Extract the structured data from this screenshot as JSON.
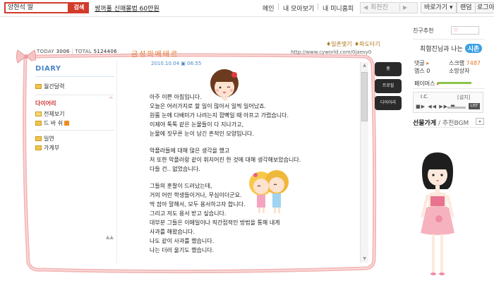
{
  "topbar": {
    "search_value": "앙현석 딸",
    "search_button": "검색",
    "promo_link": "쌍꺼풀 신매몰법 60만원",
    "nav_main": "메인",
    "nav_my_view": "내 모아보기",
    "nav_my_home": "내 미니홈피",
    "prev_label": "최천진",
    "go_dropdown": "바로가기",
    "random": "랜덤",
    "logout": "로그아웃"
  },
  "minihome": {
    "today_label": "TODAY",
    "today_count": "3006",
    "total_label": "TOTAL",
    "total_count": "5124406",
    "title": "금성의메테르",
    "url": "http://www.cyworld.com/0jaesy0",
    "link_ilchon": "일촌맺기",
    "link_pado": "파도타기"
  },
  "left_menu": {
    "title": "DIARY",
    "calendar": "월간달력",
    "folder_header": "다이어리",
    "view_all": "전체보기",
    "drabi": "드 바 쉬",
    "ilchon": "일연",
    "family": "가계부"
  },
  "post": {
    "date": "2010.10.04 ▣ 06:55",
    "lines": [
      "아주 이쁜 아침입니다.",
      "오늘은 어러가지로 할 일이 많아서 일찍 일어났죠.",
      "원룸 눈에 다배미가 나려는지 깜빡일 때 아프고 가렵습니다.",
      "이제야 톡톡 같은 눈물들이 다 지나가고,",
      "눈물에 짓무른 눈이 남긴 흔적인 모양입니다.",
      "악플러들에 대해 많은 생각을 했고",
      "저 또한 악플러랑 같이 휘지어진 한 것에 대해 생각해보았습니다.",
      "다들 건.. 없었습니다.",
      "그들의 훈찰이 드러났는데,",
      "거의 어린 학생들이거나, 무심이더군요.",
      "딱 잡아 말해서, 모두 용서하고자 합니다.",
      "그리고 저도 용서 받고 싶습니다.",
      "대부분 그들은 이메일이나 직간접적인 방법을 통해 내게",
      "사과를 해왔습니다.",
      "나도 같이 사과를 했습니다.",
      "나는 더러 울기도 했습니다."
    ]
  },
  "menu_tabs": [
    "홈",
    "프로필",
    "다이어리"
  ],
  "sidebar": {
    "friend_recommend": "친구추천",
    "relation_prefix": "최혐진님과 나는",
    "relation_value": "시촌",
    "comment_label": "댓글",
    "scrap_label": "스크랩",
    "scrap_count": "7487",
    "app_label": "앱스",
    "app_count": "0",
    "wish_label": "소망상자",
    "pms_label": "페이머스",
    "player_title": "I.C.",
    "player_settings": "[설치]",
    "gift_label": "선물가게",
    "bgm_label": "/ 추천BGM"
  },
  "colors": {
    "accent_red": "#d23b2b",
    "frame_pink": "#f3b6b6",
    "diary_blue": "#4a86c8",
    "title_orange": "#e07b2d",
    "relation_blue": "#3a9fe4"
  }
}
